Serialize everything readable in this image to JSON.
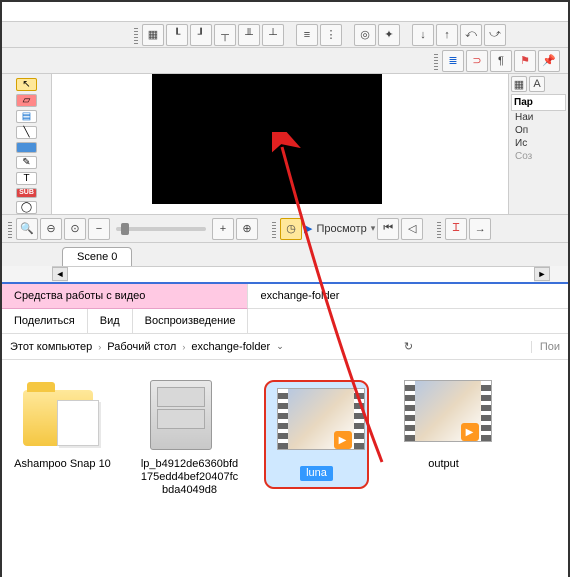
{
  "editor": {
    "scene_tab": "Scene 0",
    "preview_label": "Просмотр",
    "right_panel": {
      "title": "Пар",
      "items": [
        "Наи",
        "Оп",
        "Ис",
        "Соз"
      ]
    },
    "left_tools": [
      "pointer",
      "red-select",
      "blue-layers",
      "line",
      "rect-blue",
      "pen",
      "text",
      "sub",
      "oval"
    ],
    "sub_label": "SUB"
  },
  "explorer": {
    "tab_share": "Поделиться",
    "tab_view": "Вид",
    "tab_video_tools": "Средства работы с видео",
    "tab_playback": "Воспроизведение",
    "folder_title": "exchange-folder",
    "breadcrumb": {
      "pc": "Этот компьютер",
      "desktop": "Рабочий стол",
      "folder": "exchange-folder"
    },
    "search_placeholder": "Пои",
    "files": [
      {
        "name": "Ashampoo Snap 10",
        "type": "folder"
      },
      {
        "name": "lp_b4912de6360bfd175edd4bef20407fcbda4049d8",
        "type": "cabinet"
      },
      {
        "name": "luna",
        "type": "video",
        "selected": true
      },
      {
        "name": "output",
        "type": "video"
      }
    ]
  }
}
